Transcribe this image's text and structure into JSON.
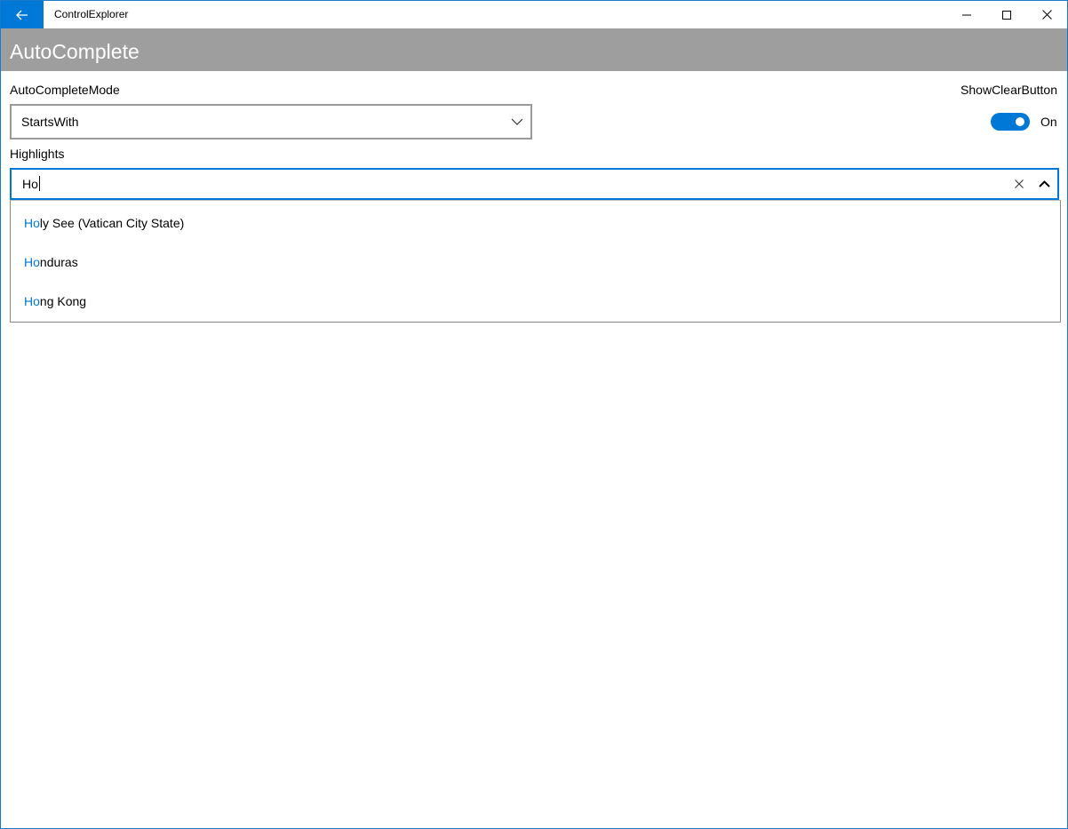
{
  "window": {
    "title": "ControlExplorer",
    "back_icon": "back-arrow-icon",
    "controls": [
      "minimize-icon",
      "maximize-icon",
      "close-icon"
    ]
  },
  "header": {
    "title": "AutoComplete"
  },
  "autocomplete_mode": {
    "label": "AutoCompleteMode",
    "value": "StartsWith"
  },
  "show_clear_button": {
    "label": "ShowClearButton",
    "state": "On"
  },
  "highlights": {
    "label": "Highlights",
    "value": "Ho",
    "suggestions": [
      {
        "match": "Ho",
        "rest": "ly See (Vatican City State)"
      },
      {
        "match": "Ho",
        "rest": "nduras"
      },
      {
        "match": "Ho",
        "rest": "ng Kong"
      }
    ]
  },
  "colors": {
    "accent": "#0078d7",
    "header_bg": "#9e9e9e"
  }
}
